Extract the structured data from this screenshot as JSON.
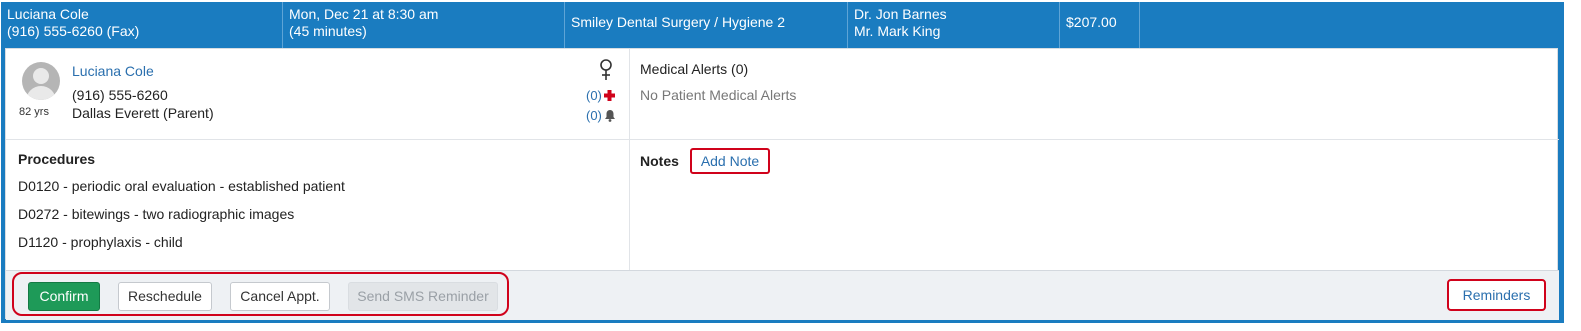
{
  "appointment": {
    "patient_name": "Luciana Cole",
    "fax": "(916) 555-6260 (Fax)",
    "date": "Mon, Dec 21 at 8:30 am",
    "duration": "(45 minutes)",
    "location": "Smiley Dental Surgery / Hygiene 2",
    "provider_1": "Dr. Jon Barnes",
    "provider_2": "Mr. Mark King",
    "amount": "$207.00"
  },
  "patient": {
    "name": "Luciana Cole",
    "age": "82 yrs",
    "phone": "(916) 555-6260",
    "guardian": "Dallas Everett (Parent)",
    "medical_flag_count": "(0)",
    "alert_flag_count": "(0)",
    "gender_icon": "female-icon"
  },
  "medical_alerts": {
    "title": "Medical Alerts (0)",
    "empty_text": "No Patient Medical Alerts"
  },
  "procedures": {
    "title": "Procedures",
    "items": [
      "D0120 - periodic oral evaluation - established patient",
      "D0272 - bitewings - two radiographic images",
      "D1120 - prophylaxis - child"
    ]
  },
  "notes": {
    "title": "Notes",
    "add_label": "Add Note"
  },
  "actions": {
    "confirm": "Confirm",
    "reschedule": "Reschedule",
    "cancel": "Cancel Appt.",
    "send_sms": "Send SMS Reminder",
    "reminders": "Reminders"
  },
  "colors": {
    "header_bg": "#1a7cc0",
    "confirm_bg": "#1e9a58",
    "highlight_red": "#d0021b",
    "link_blue": "#2a6fae"
  }
}
